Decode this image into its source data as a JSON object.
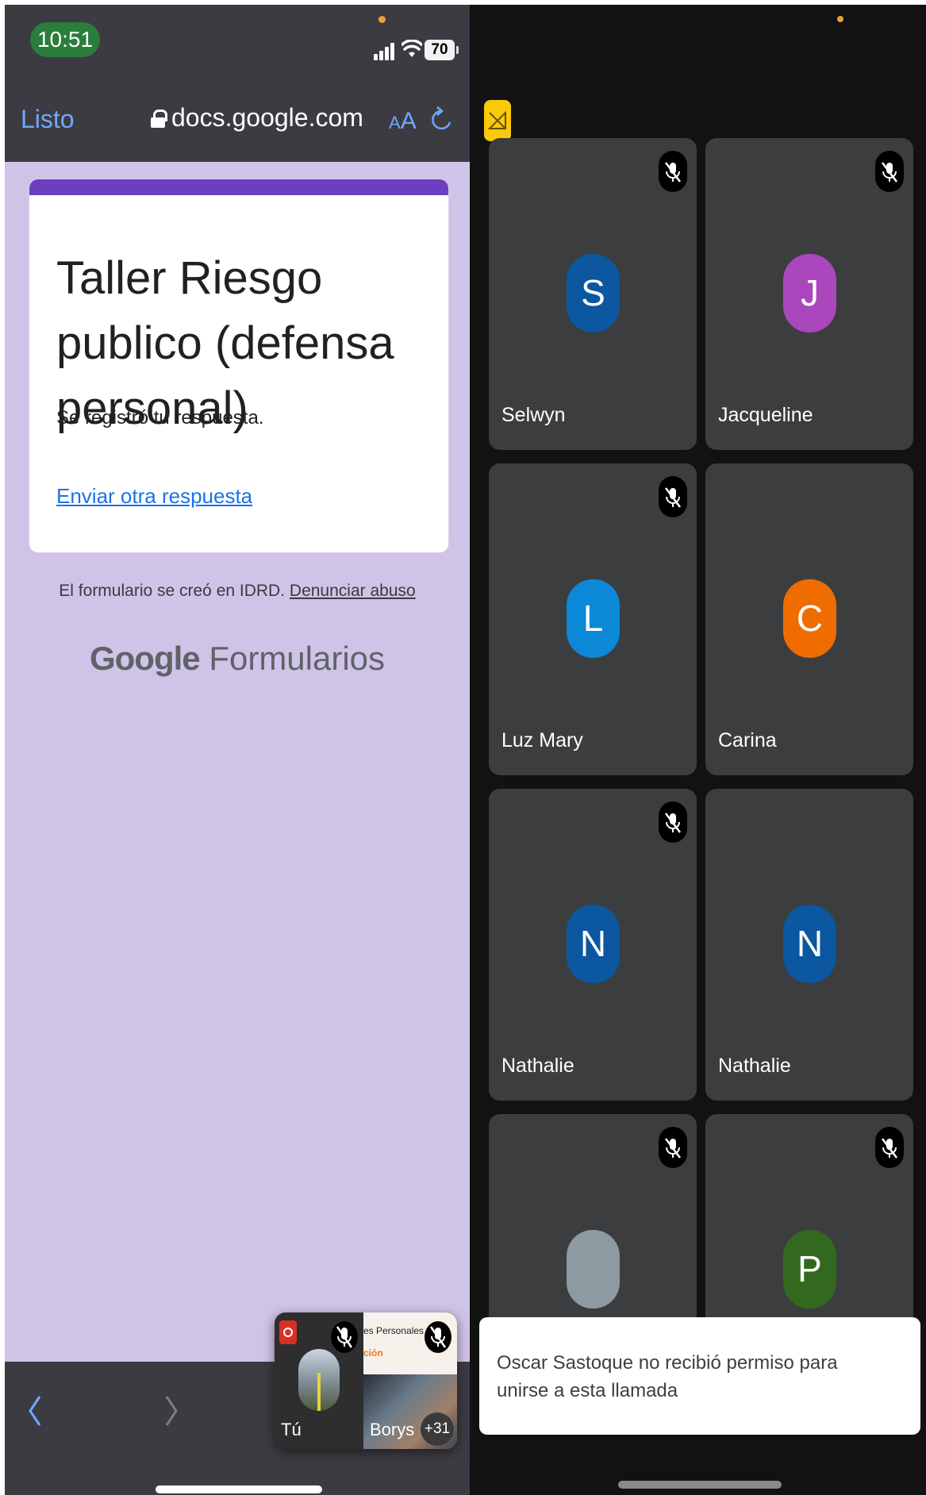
{
  "status_bar": {
    "time": "10:51",
    "battery": "70"
  },
  "browser": {
    "done_label": "Listo",
    "url": "docs.google.com",
    "text_size_small": "A",
    "text_size_big": "A"
  },
  "form": {
    "title": "Taller Riesgo publico (defensa personal)",
    "confirmation": "Se registró tu respuesta.",
    "another_response_link": "Enviar otra respuesta",
    "footer_text": "El formulario se creó en IDRD. ",
    "report_abuse_link": "Denunciar abuso",
    "logo_google": "Google",
    "logo_forms": "Formularios"
  },
  "pip": {
    "self_name": "Tú",
    "other_name": "Borys",
    "other_slide_line1": "es Personales",
    "other_slide_line2": "ción",
    "more_count": "+31"
  },
  "meet": {
    "participants": [
      {
        "initial": "S",
        "name": "Selwyn",
        "color": "#0b57a0",
        "muted": true
      },
      {
        "initial": "J",
        "name": "Jacqueline",
        "color": "#aa47bc",
        "muted": true
      },
      {
        "initial": "L",
        "name": "Luz Mary",
        "color": "#0b88d8",
        "muted": true
      },
      {
        "initial": "C",
        "name": "Carina",
        "color": "#ef6c00",
        "muted": false
      },
      {
        "initial": "N",
        "name": "Nathalie",
        "color": "#0b57a0",
        "muted": true
      },
      {
        "initial": "N",
        "name": "Nathalie",
        "color": "#0b57a0",
        "muted": false
      },
      {
        "initial": "",
        "name": "",
        "color": "#8e9aa1",
        "muted": true
      },
      {
        "initial": "P",
        "name": "",
        "color": "#33691e",
        "muted": true
      }
    ],
    "toast": "Oscar Sastoque no recibió permiso para unirse a esta llamada"
  },
  "colors": {
    "form_accent": "#6b3fc0",
    "form_background": "#d0c3e8",
    "safari_chrome": "#3d3b42",
    "link_blue": "#1a73e8",
    "meet_background": "#121212",
    "meet_tile": "#3c3d3f"
  }
}
